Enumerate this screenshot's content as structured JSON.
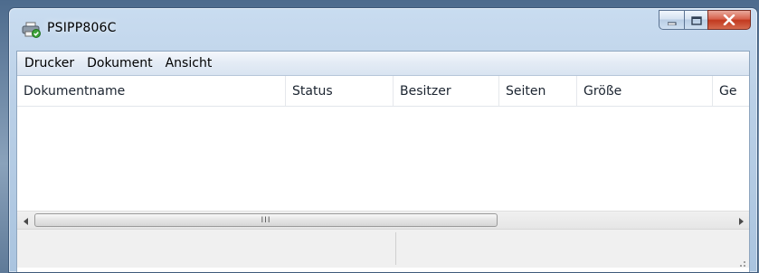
{
  "window": {
    "title": "PSIPP806C",
    "icon": "printer-icon"
  },
  "caption_buttons": {
    "minimize_icon": "minimize-icon",
    "maximize_icon": "maximize-icon",
    "close_icon": "close-icon"
  },
  "menu": {
    "items": [
      "Drucker",
      "Dokument",
      "Ansicht"
    ]
  },
  "list": {
    "columns": [
      "Dokumentname",
      "Status",
      "Besitzer",
      "Seiten",
      "Größe",
      "Ge"
    ],
    "rows": []
  },
  "scrollbar": {
    "left_arrow": "scroll-left-icon",
    "right_arrow": "scroll-right-icon",
    "thumb_grip": "III"
  },
  "statusbar": {
    "panes": [
      "",
      ""
    ]
  },
  "colors": {
    "close_button": "#c1391f",
    "window_frame": "#b9cfe6"
  }
}
